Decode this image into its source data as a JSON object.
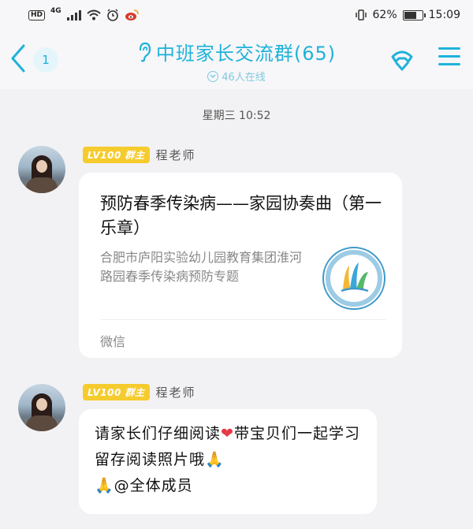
{
  "status_bar": {
    "hd": "HD",
    "network": "4G",
    "battery_percent": "62%",
    "time": "15:09",
    "battery_level": 0.62
  },
  "header": {
    "unread_count": "1",
    "title": "中班家长交流群(65)",
    "online": "46人在线",
    "accent_color": "#1fb2da"
  },
  "chat": {
    "timestamp": "星期三 10:52",
    "messages": [
      {
        "badge": "LV100 群主",
        "sender": "程老师",
        "type": "card",
        "card_title": "预防春季传染病——家园协奏曲（第一乐章）",
        "card_desc": "合肥市庐阳实验幼儿园教育集团淮河路园春季传染病预防专题",
        "card_source": "微信"
      },
      {
        "badge": "LV100 群主",
        "sender": "程老师",
        "type": "text",
        "text_part1": "请家长们仔细阅读",
        "heart": "❤",
        "text_part2": "带宝贝们一起学习留存阅读照片哦",
        "pray1": "🙏",
        "pray2": "🙏",
        "mention": "@全体成员"
      }
    ]
  },
  "icons": {
    "back": "chevron-left-icon",
    "ear": "ear-icon",
    "phone": "phone-icon",
    "menu": "menu-icon"
  }
}
